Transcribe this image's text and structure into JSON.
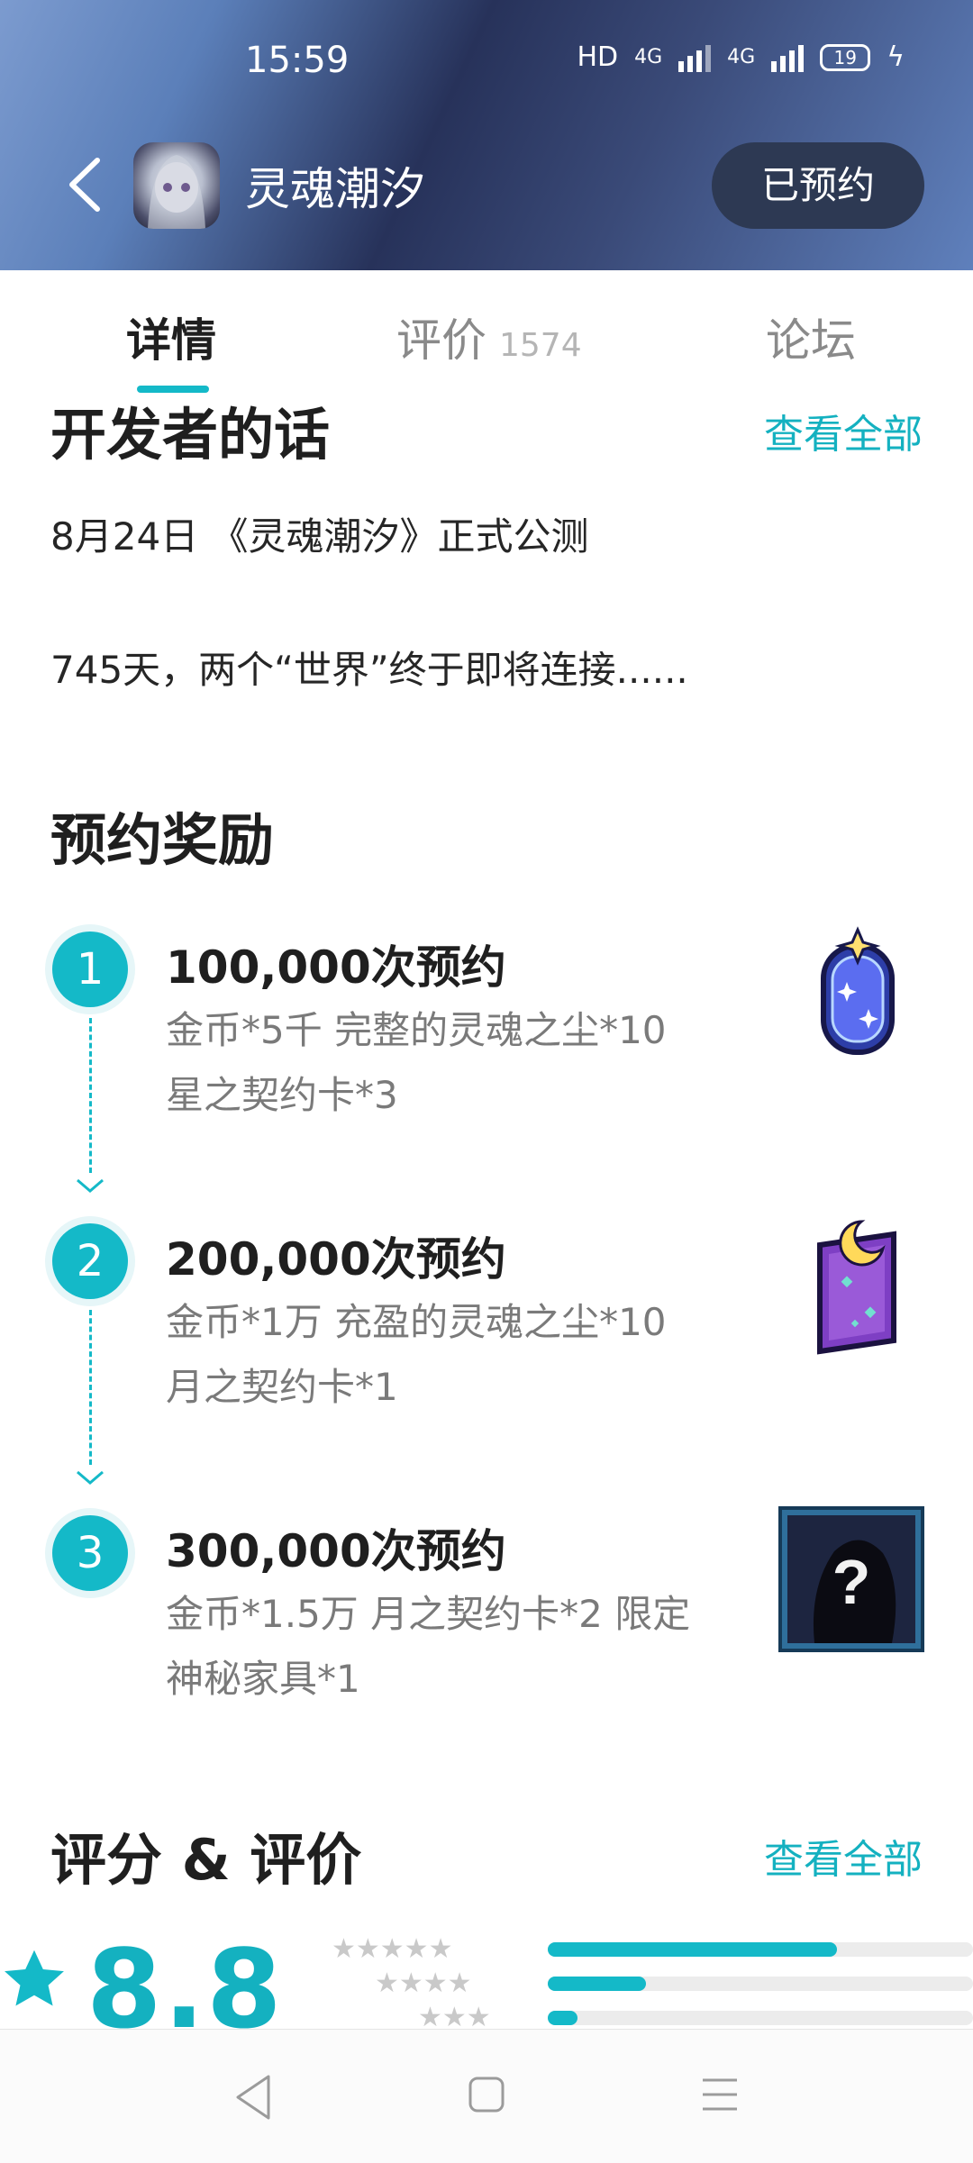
{
  "status_bar": {
    "time": "15:59",
    "hd_label": "HD",
    "network_1": "4G",
    "network_2": "4G",
    "battery": "19"
  },
  "header": {
    "app_name": "灵魂潮汐",
    "reserve_button": "已预约"
  },
  "tabs": [
    {
      "label": "详情",
      "active": true
    },
    {
      "label": "评价",
      "count": "1574"
    },
    {
      "label": "论坛"
    }
  ],
  "developer": {
    "title": "开发者的话",
    "view_all": "查看全部",
    "line1": "8月24日 《灵魂潮汐》正式公测",
    "line2": "745天，两个“世界”终于即将连接......"
  },
  "rewards": {
    "title": "预约奖励",
    "items": [
      {
        "num": "1",
        "title": "100,000次预约",
        "line1": "金币*5千 完整的灵魂之尘*10",
        "line2": "星之契约卡*3",
        "icon": "star-contract-card-icon"
      },
      {
        "num": "2",
        "title": "200,000次预约",
        "line1": "金币*1万 充盈的灵魂之尘*10",
        "line2": "月之契约卡*1",
        "icon": "moon-contract-card-icon"
      },
      {
        "num": "3",
        "title": "300,000次预约",
        "line1": "金币*1.5万 月之契约卡*2 限定",
        "line2": "神秘家具*1",
        "icon": "mystery-furniture-icon"
      }
    ]
  },
  "ratings": {
    "title": "评分 & 评价",
    "view_all": "查看全部",
    "score": "8.8",
    "distribution": [
      0.68,
      0.23,
      0.07
    ],
    "accent": "#14b9c8"
  }
}
